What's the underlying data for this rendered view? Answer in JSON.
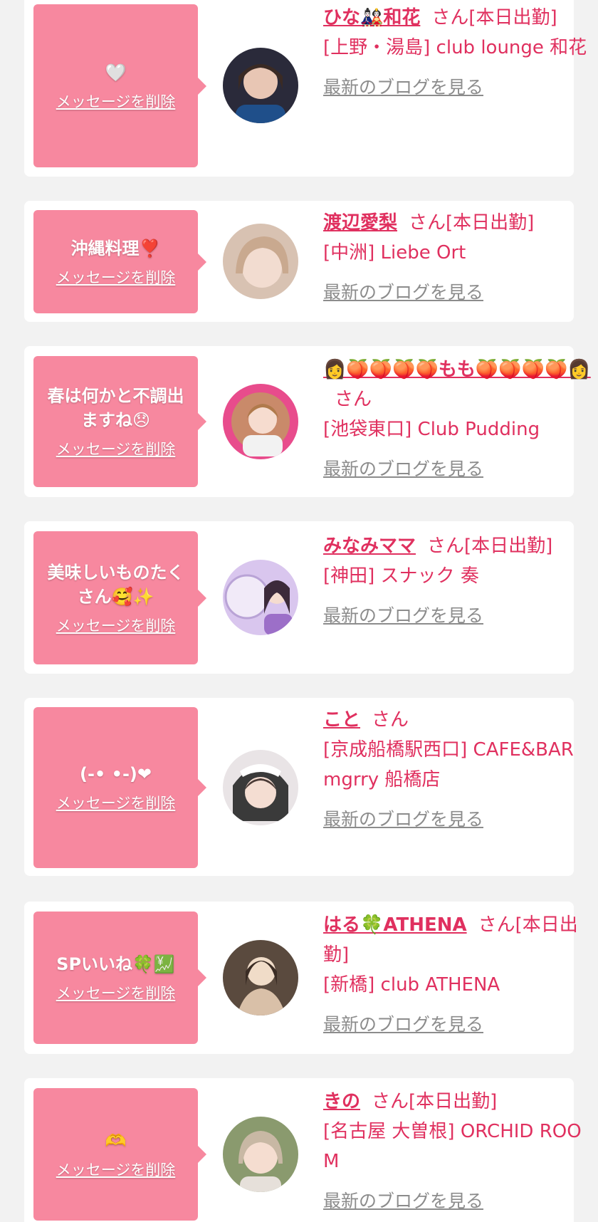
{
  "entries": [
    {
      "message": "🤍",
      "delete_label": "メッセージを削除",
      "name": "ひな🎎和花",
      "san": "さん[本日出勤]",
      "shop": "[上野・湯島] club lounge 和花",
      "blog_label": "最新のブログを見る",
      "avatar_colors": [
        "#2a2a3a",
        "#e8c6b4",
        "#1f4f8a"
      ]
    },
    {
      "message": "沖縄料理❣️",
      "delete_label": "メッセージを削除",
      "name": "渡辺愛梨",
      "san": "さん[本日出勤]",
      "shop": "[中洲] Liebe Ort",
      "blog_label": "最新のブログを見る",
      "avatar_colors": [
        "#d8c2b2",
        "#f2dcd0",
        "#c9a98f"
      ]
    },
    {
      "message": "春は何かと不調出ますね😞",
      "delete_label": "メッセージを削除",
      "name": "👩🍑🍑🍑🍑もも🍑🍑🍑🍑👩",
      "san": "さん",
      "shop": "[池袋東口] Club Pudding",
      "blog_label": "最新のブログを見る",
      "avatar_colors": [
        "#e84c8c",
        "#f6dccf",
        "#b07a4c"
      ]
    },
    {
      "message": "美味しいものたくさん🥰✨",
      "delete_label": "メッセージを削除",
      "name": "みなみママ",
      "san": "さん[本日出勤]",
      "shop": "[神田] スナック 奏",
      "blog_label": "最新のブログを見る",
      "avatar_colors": [
        "#d9c6ee",
        "#f1eaf8",
        "#9c6fc8"
      ]
    },
    {
      "message": "(-• •-)❤",
      "delete_label": "メッセージを削除",
      "name": "こと",
      "san": "さん",
      "shop": "[京成船橋駅西口] CAFE&BAR mgrry 船橋店",
      "blog_label": "最新のブログを見る",
      "avatar_colors": [
        "#3a3a3a",
        "#f4ddd2",
        "#ffffff"
      ]
    },
    {
      "message": "SPいいね🍀💹",
      "delete_label": "メッセージを削除",
      "name": "はる🍀ATHENA",
      "san": "さん[本日出勤]",
      "shop": "[新橋] club ATHENA",
      "blog_label": "最新のブログを見る",
      "avatar_colors": [
        "#5a4a3e",
        "#f0dcc8",
        "#d9c0a8"
      ]
    },
    {
      "message": "🫶",
      "delete_label": "メッセージを削除",
      "name": "きの",
      "san": "さん[本日出勤]",
      "shop": "[名古屋 大曽根] ORCHID ROOM",
      "blog_label": "最新のブログを見る",
      "avatar_colors": [
        "#8a9a6e",
        "#f5ddd0",
        "#c8b8a4"
      ]
    }
  ]
}
